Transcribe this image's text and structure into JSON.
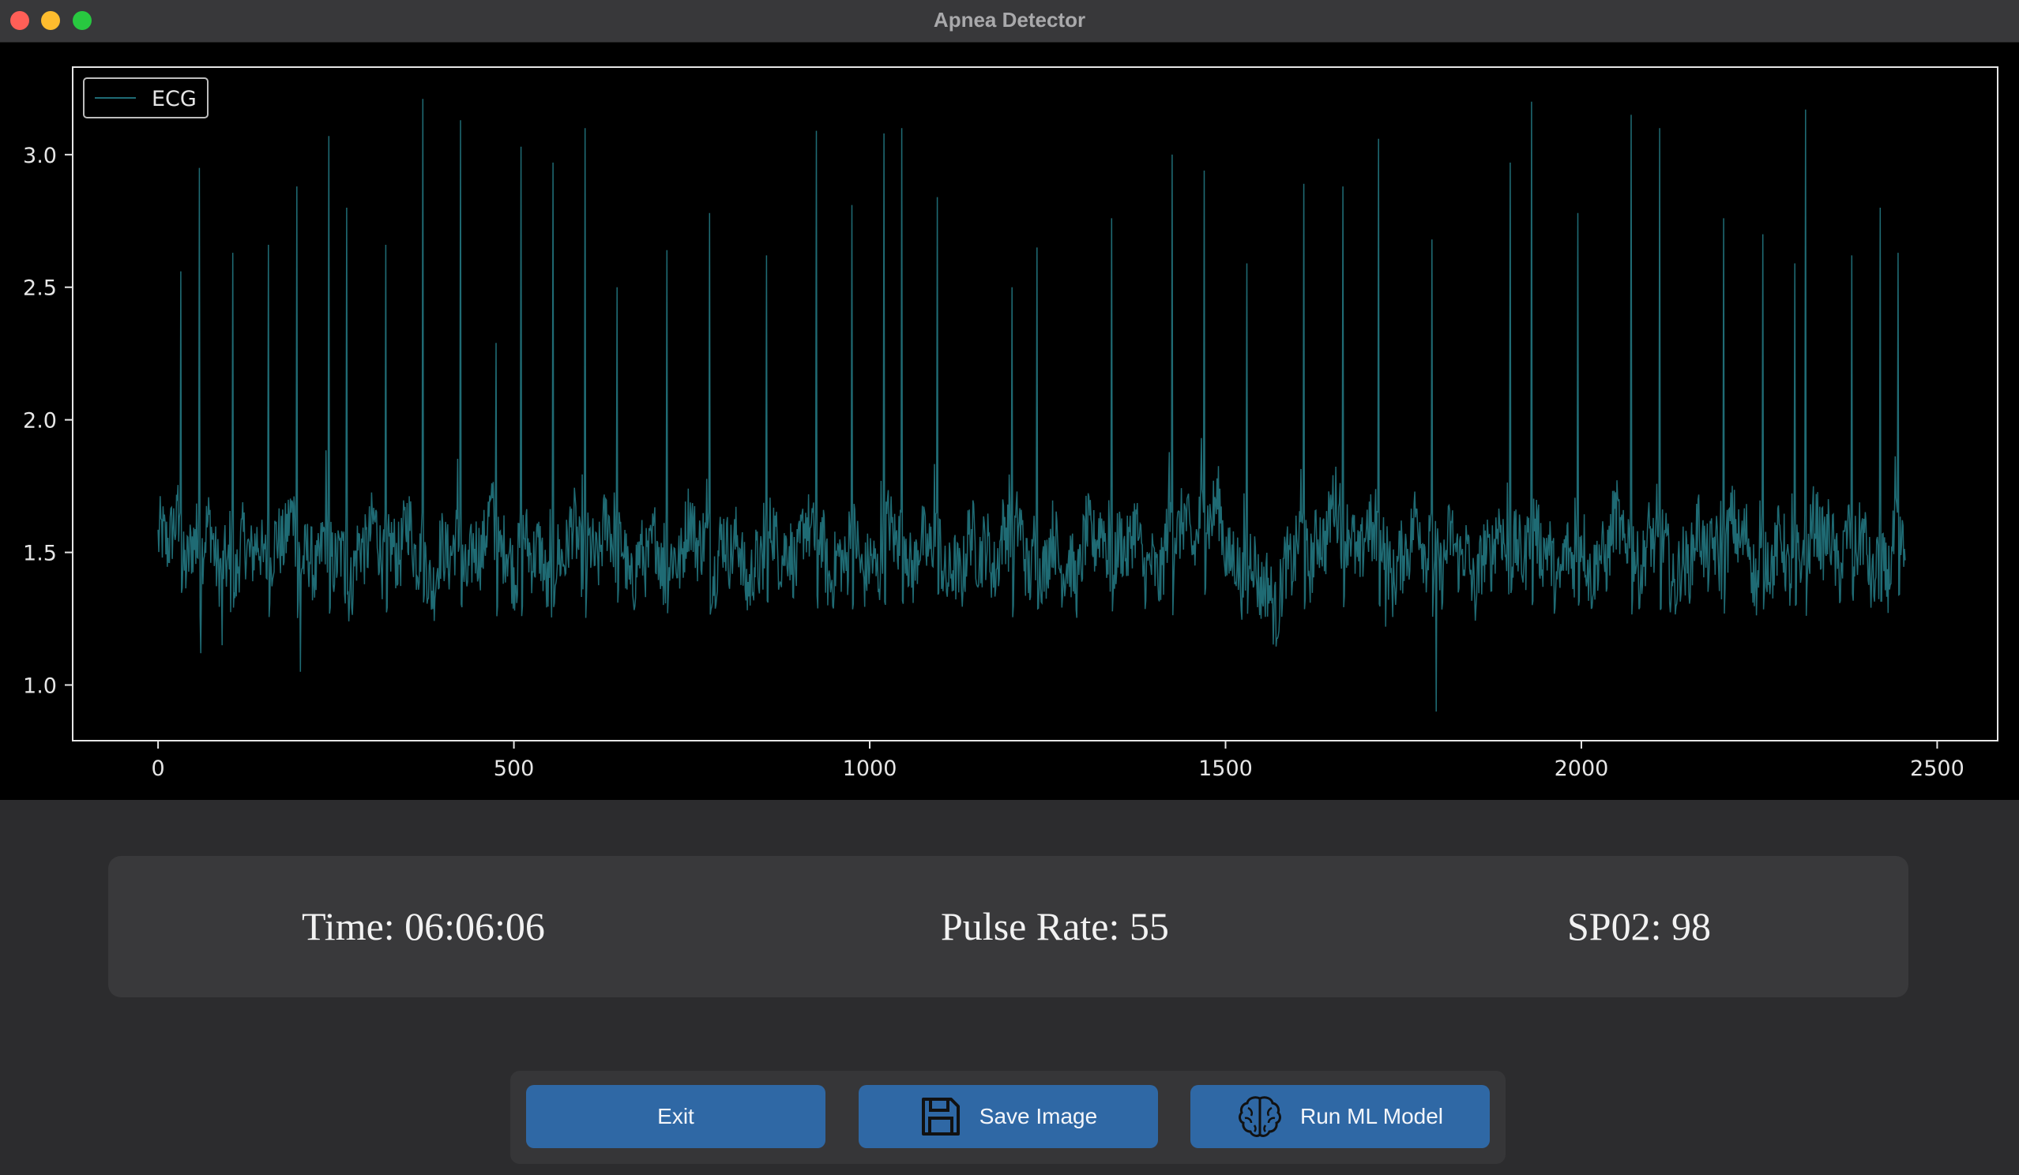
{
  "window": {
    "title": "Apnea Detector"
  },
  "stats": {
    "time_label": "Time: 06:06:06",
    "pulse_label": "Pulse Rate: 55",
    "spo2_label": "SP02: 98"
  },
  "buttons": {
    "exit": "Exit",
    "save": "Save Image",
    "ml": "Run ML Model"
  },
  "icons": {
    "save": "floppy-disk-icon",
    "ml": "brain-icon"
  },
  "colors": {
    "plot_bg": "#000000",
    "line": "#1f6b74",
    "axis": "#e6e6e6",
    "button": "#2f68a5",
    "panel": "#39393b"
  },
  "chart_data": {
    "type": "line",
    "title": "",
    "xlabel": "",
    "ylabel": "",
    "xlim": [
      -120,
      2585
    ],
    "ylim": [
      0.79,
      3.33
    ],
    "xticks": [
      0,
      500,
      1000,
      1500,
      2000,
      2500
    ],
    "yticks": [
      1.0,
      1.5,
      2.0,
      2.5,
      3.0
    ],
    "grid": false,
    "legend": {
      "position": "top-left",
      "entries": [
        "ECG"
      ]
    },
    "series": [
      {
        "name": "ECG",
        "x_start": 0,
        "x_end": 2455,
        "baseline": 1.5,
        "r_peaks": [
          [
            32,
            2.56
          ],
          [
            58,
            2.95
          ],
          [
            105,
            2.63
          ],
          [
            155,
            2.66
          ],
          [
            195,
            2.88
          ],
          [
            240,
            3.07
          ],
          [
            265,
            2.8
          ],
          [
            320,
            2.66
          ],
          [
            372,
            3.21
          ],
          [
            425,
            3.13
          ],
          [
            475,
            2.29
          ],
          [
            510,
            3.03
          ],
          [
            555,
            2.97
          ],
          [
            600,
            3.1
          ],
          [
            645,
            2.5
          ],
          [
            715,
            2.64
          ],
          [
            775,
            2.78
          ],
          [
            855,
            2.62
          ],
          [
            925,
            3.09
          ],
          [
            975,
            2.81
          ],
          [
            1020,
            3.08
          ],
          [
            1045,
            3.1
          ],
          [
            1095,
            2.84
          ],
          [
            1200,
            2.5
          ],
          [
            1235,
            2.65
          ],
          [
            1340,
            2.76
          ],
          [
            1425,
            3.0
          ],
          [
            1470,
            2.94
          ],
          [
            1530,
            2.59
          ],
          [
            1610,
            2.89
          ],
          [
            1665,
            2.88
          ],
          [
            1715,
            3.06
          ],
          [
            1790,
            2.68
          ],
          [
            1900,
            2.97
          ],
          [
            1930,
            3.2
          ],
          [
            1995,
            2.78
          ],
          [
            2070,
            3.15
          ],
          [
            2110,
            3.1
          ],
          [
            2200,
            2.76
          ],
          [
            2255,
            2.7
          ],
          [
            2300,
            2.59
          ],
          [
            2315,
            3.17
          ],
          [
            2380,
            2.62
          ],
          [
            2420,
            2.8
          ],
          [
            2445,
            2.63
          ]
        ],
        "troughs": [
          [
            200,
            1.05
          ],
          [
            1796,
            0.9
          ],
          [
            60,
            1.12
          ],
          [
            90,
            1.15
          ],
          [
            1725,
            1.22
          ]
        ]
      }
    ]
  }
}
